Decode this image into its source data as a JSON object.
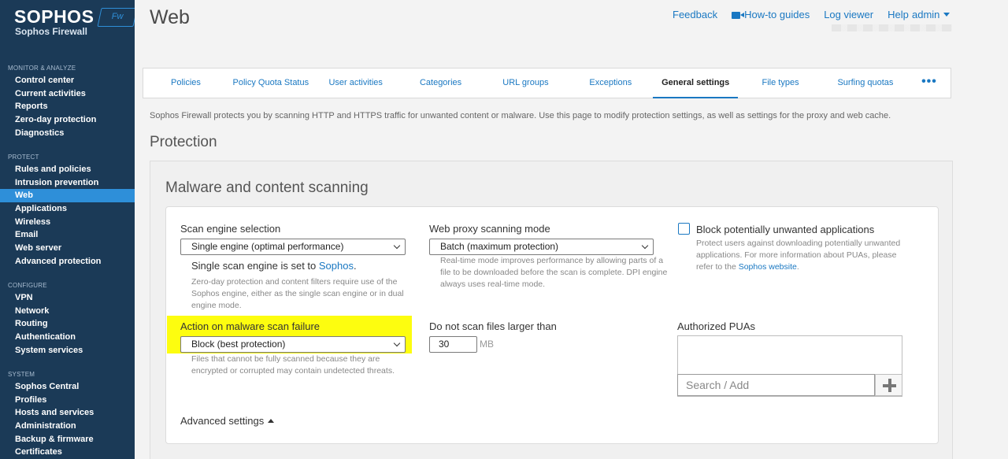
{
  "brand": {
    "logo_text": "SOPHOS",
    "badge": "Fw",
    "product": "Sophos Firewall"
  },
  "sidebar": {
    "sections": [
      {
        "heading": "MONITOR & ANALYZE",
        "items": [
          "Control center",
          "Current activities",
          "Reports",
          "Zero-day protection",
          "Diagnostics"
        ]
      },
      {
        "heading": "PROTECT",
        "items": [
          "Rules and policies",
          "Intrusion prevention",
          "Web",
          "Applications",
          "Wireless",
          "Email",
          "Web server",
          "Advanced protection"
        ]
      },
      {
        "heading": "CONFIGURE",
        "items": [
          "VPN",
          "Network",
          "Routing",
          "Authentication",
          "System services"
        ]
      },
      {
        "heading": "SYSTEM",
        "items": [
          "Sophos Central",
          "Profiles",
          "Hosts and services",
          "Administration",
          "Backup & firmware",
          "Certificates"
        ]
      }
    ],
    "active_item": "Web"
  },
  "header": {
    "title": "Web",
    "links": {
      "feedback": "Feedback",
      "howto": "How-to guides",
      "log_viewer": "Log viewer",
      "help": "Help"
    },
    "user": "admin"
  },
  "tabs": [
    "Policies",
    "Policy Quota Status",
    "User activities",
    "Categories",
    "URL groups",
    "Exceptions",
    "General settings",
    "File types",
    "Surfing quotas"
  ],
  "active_tab": "General settings",
  "more_tabs": "•••",
  "intro": "Sophos Firewall protects you by scanning HTTP and HTTPS traffic for unwanted content or malware. Use this page to modify protection settings, as well as settings for the proxy and web cache.",
  "section_title": "Protection",
  "card": {
    "title": "Malware and content scanning",
    "scan_engine": {
      "label": "Scan engine selection",
      "value": "Single engine (optimal performance)",
      "status_prefix": "Single scan engine is set to ",
      "status_link": "Sophos",
      "status_suffix": ".",
      "help": "Zero-day protection and content filters require use of the Sophos engine, either as the single scan engine or in dual engine mode."
    },
    "proxy_mode": {
      "label": "Web proxy scanning mode",
      "value": "Batch (maximum protection)",
      "help": "Real-time mode improves performance by allowing parts of a file to be downloaded before the scan is complete. DPI engine always uses real-time mode."
    },
    "pua": {
      "label": "Block potentially unwanted applications",
      "checked": false,
      "help_prefix": "Protect users against downloading potentially unwanted applications. For more information about PUAs, please refer to the ",
      "help_link": "Sophos website",
      "help_suffix": "."
    },
    "scan_failure": {
      "label": "Action on malware scan failure",
      "value": "Block (best protection)",
      "help": "Files that cannot be fully scanned because they are encrypted or corrupted may contain undetected threats."
    },
    "max_size": {
      "label": "Do not scan files larger than",
      "value": "30",
      "unit": "MB"
    },
    "authorized_puas": {
      "label": "Authorized PUAs",
      "placeholder": "Search / Add"
    },
    "advanced": "Advanced settings"
  },
  "colors": {
    "sidebar_bg": "#1b3a57",
    "accent": "#2e8fd9",
    "link": "#1a78c2",
    "highlight": "#fdfd0f"
  }
}
